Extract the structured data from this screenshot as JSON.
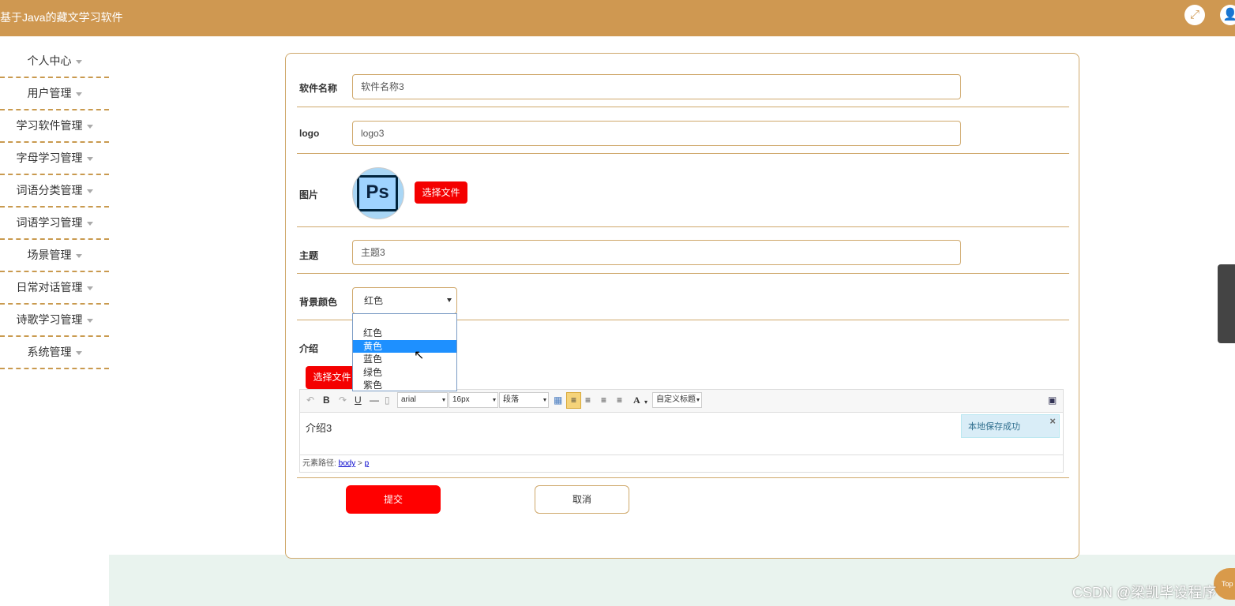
{
  "header": {
    "title": "基于Java的藏文学习软件"
  },
  "sidebar": {
    "items": [
      {
        "label": "个人中心"
      },
      {
        "label": "用户管理"
      },
      {
        "label": "学习软件管理"
      },
      {
        "label": "字母学习管理"
      },
      {
        "label": "词语分类管理"
      },
      {
        "label": "词语学习管理"
      },
      {
        "label": "场景管理"
      },
      {
        "label": "日常对话管理"
      },
      {
        "label": "诗歌学习管理"
      },
      {
        "label": "系统管理"
      }
    ]
  },
  "form": {
    "name_label": "软件名称",
    "name_value": "软件名称3",
    "logo_label": "logo",
    "logo_value": "logo3",
    "image_label": "图片",
    "image_text": "Ps",
    "choose_file": "选择文件",
    "theme_label": "主题",
    "theme_value": "主题3",
    "bg_label": "背景颜色",
    "bg_selected": "红色",
    "bg_options": [
      "红色",
      "黄色",
      "蓝色",
      "绿色",
      "紫色"
    ],
    "intro_label": "介绍",
    "intro_choose_file": "选择文件",
    "submit": "提交",
    "cancel": "取消"
  },
  "editor": {
    "font_family": "arial",
    "font_size": "16px",
    "paragraph": "段落",
    "custom_heading": "自定义标题",
    "content": "介绍3",
    "toast": "本地保存成功",
    "path_label": "元素路径:",
    "path_body": "body",
    "path_sep": ">",
    "path_p": "p"
  },
  "misc": {
    "top_button": "Top",
    "watermark": "CSDN @梁凯毕设程序"
  }
}
